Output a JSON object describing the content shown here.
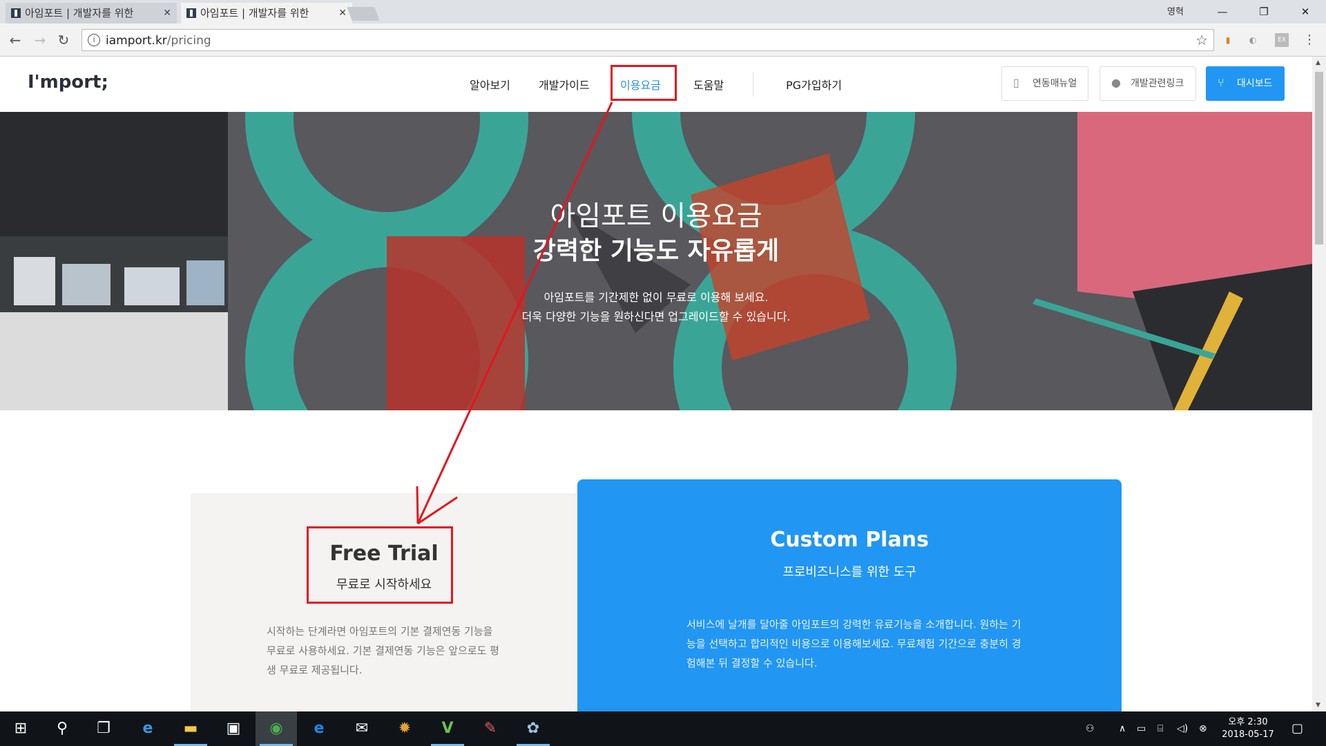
{
  "browser": {
    "tabs": [
      {
        "title": "아임포트 | 개발자를 위한",
        "close": "✕"
      },
      {
        "title": "아임포트 | 개발자를 위한",
        "close": "✕"
      }
    ],
    "profile_label": "영혁",
    "window_controls": {
      "minimize": "—",
      "maximize": "❐",
      "close": "✕"
    },
    "url_host": "iamport.kr",
    "url_path": "/pricing",
    "icons": {
      "back": "back-arrow-icon",
      "forward": "forward-arrow-icon",
      "reload": "reload-icon",
      "info": "info-icon",
      "star": "bookmark-star-icon",
      "menu": "kebab-menu-icon"
    }
  },
  "site": {
    "logo": "I'mport;",
    "nav": [
      "알아보기",
      "개발가이드",
      "이용요금",
      "도움말",
      "PG가입하기"
    ],
    "active_nav": "이용요금",
    "buttons": {
      "manual": "연동매뉴얼",
      "dev_links": "개발관련링크",
      "dashboard": "대시보드"
    },
    "accent_color": "#2196f3"
  },
  "hero": {
    "title": "아임포트 이용요금",
    "subtitle": "강력한 기능도 자유롭게",
    "desc_line1": "아임포트를 기간제한 없이 무료로 이용해 보세요.",
    "desc_line2": "더욱 다양한 기능을 원하신다면 업그레이드할 수 있습니다."
  },
  "plans": {
    "free": {
      "title": "Free Trial",
      "subtitle": "무료로 시작하세요",
      "description": "시작하는 단계라면 아임포트의 기본 결제연동 기능을 무료로 사용하세요. 기본 결제연동 기능은 앞으로도 평생 무료로 제공됩니다."
    },
    "custom": {
      "title": "Custom Plans",
      "subtitle": "프로비즈니스를 위한 도구",
      "description": "서비스에 날개를 달아줄 아임포트의 강력한 유료기능을 소개합니다. 원하는 기능을 선택하고 합리적인 비용으로 이용해보세요. 무료체험 기간으로 충분히 경험해본 뒤 결정할 수 있습니다."
    }
  },
  "annotation_color": "#e3161e",
  "taskbar": {
    "clock_time": "오후 2:30",
    "clock_date": "2018-05-17"
  }
}
